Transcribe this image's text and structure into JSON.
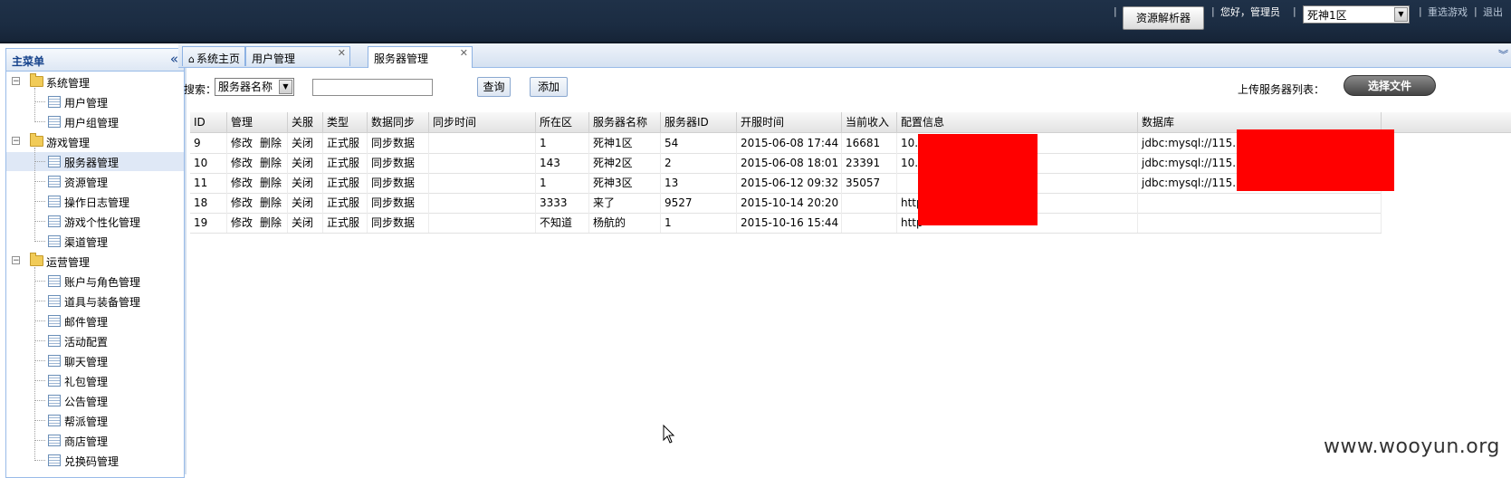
{
  "topbar": {
    "resource_button": "资源解析器",
    "greeting": "您好，管理员",
    "server_select": "死神1区",
    "reselect_link": "重选游戏",
    "logout_link": "退出",
    "separator": "|"
  },
  "sidebar": {
    "title": "主菜单",
    "collapse_icon": "«",
    "groups": [
      {
        "label": "系统管理",
        "items": [
          "用户管理",
          "用户组管理"
        ]
      },
      {
        "label": "游戏管理",
        "items": [
          "服务器管理",
          "资源管理",
          "操作日志管理",
          "游戏个性化管理",
          "渠道管理"
        ]
      },
      {
        "label": "运营管理",
        "items": [
          "账户与角色管理",
          "道具与装备管理",
          "邮件管理",
          "活动配置",
          "聊天管理",
          "礼包管理",
          "公告管理",
          "帮派管理",
          "商店管理",
          "兑换码管理"
        ]
      }
    ],
    "selected_item": "服务器管理"
  },
  "tabs": [
    {
      "label": "系统主页",
      "closable": false
    },
    {
      "label": "用户管理",
      "closable": true
    },
    {
      "label": "服务器管理",
      "closable": true,
      "active": true
    }
  ],
  "search": {
    "label": "搜索：",
    "field_select": "服务器名称",
    "query_value": "",
    "query_button": "查询",
    "add_button": "添加",
    "upload_label": "上传服务器列表：",
    "file_button": "选择文件"
  },
  "grid": {
    "columns": [
      "ID",
      "管理",
      "关服",
      "类型",
      "数据同步",
      "同步时间",
      "所在区",
      "服务器名称",
      "服务器ID",
      "开服时间",
      "当前收入",
      "配置信息",
      "数据库"
    ],
    "rows": [
      {
        "id": "9",
        "edit": "修改",
        "del": "删除",
        "close": "关闭",
        "type": "正式服",
        "sync": "同步数据",
        "sync_time": "",
        "zone": "1",
        "name": "死神1区",
        "server_id": "54",
        "open_time": "2015-06-08 17:44",
        "income": "16681",
        "config": "10.1",
        "db": "jdbc:mysql://115.15"
      },
      {
        "id": "10",
        "edit": "修改",
        "del": "删除",
        "close": "关闭",
        "type": "正式服",
        "sync": "同步数据",
        "sync_time": "",
        "zone": "143",
        "name": "死神2区",
        "server_id": "2",
        "open_time": "2015-06-08 18:01",
        "income": "23391",
        "config": "10.1",
        "db": "jdbc:mysql://115.15"
      },
      {
        "id": "11",
        "edit": "修改",
        "del": "删除",
        "close": "关闭",
        "type": "正式服",
        "sync": "同步数据",
        "sync_time": "",
        "zone": "1",
        "name": "死神3区",
        "server_id": "13",
        "open_time": "2015-06-12 09:32",
        "income": "35057",
        "config": "",
        "db": "jdbc:mysql://115.15"
      },
      {
        "id": "18",
        "edit": "修改",
        "del": "删除",
        "close": "关闭",
        "type": "正式服",
        "sync": "同步数据",
        "sync_time": "",
        "zone": "3333",
        "name": "来了",
        "server_id": "9527",
        "open_time": "2015-10-14 20:20",
        "income": "",
        "config": "http",
        "db": ""
      },
      {
        "id": "19",
        "edit": "修改",
        "del": "删除",
        "close": "关闭",
        "type": "正式服",
        "sync": "同步数据",
        "sync_time": "",
        "zone": "不知道",
        "name": "杨航的",
        "server_id": "1",
        "open_time": "2015-10-16 15:44",
        "income": "",
        "config": "http",
        "db": ""
      }
    ]
  },
  "watermark": "www.wooyun.org",
  "colors": {
    "redaction": "#ff0000",
    "topbar": "#1b2c42",
    "selected_row": "#dfe8f6"
  }
}
